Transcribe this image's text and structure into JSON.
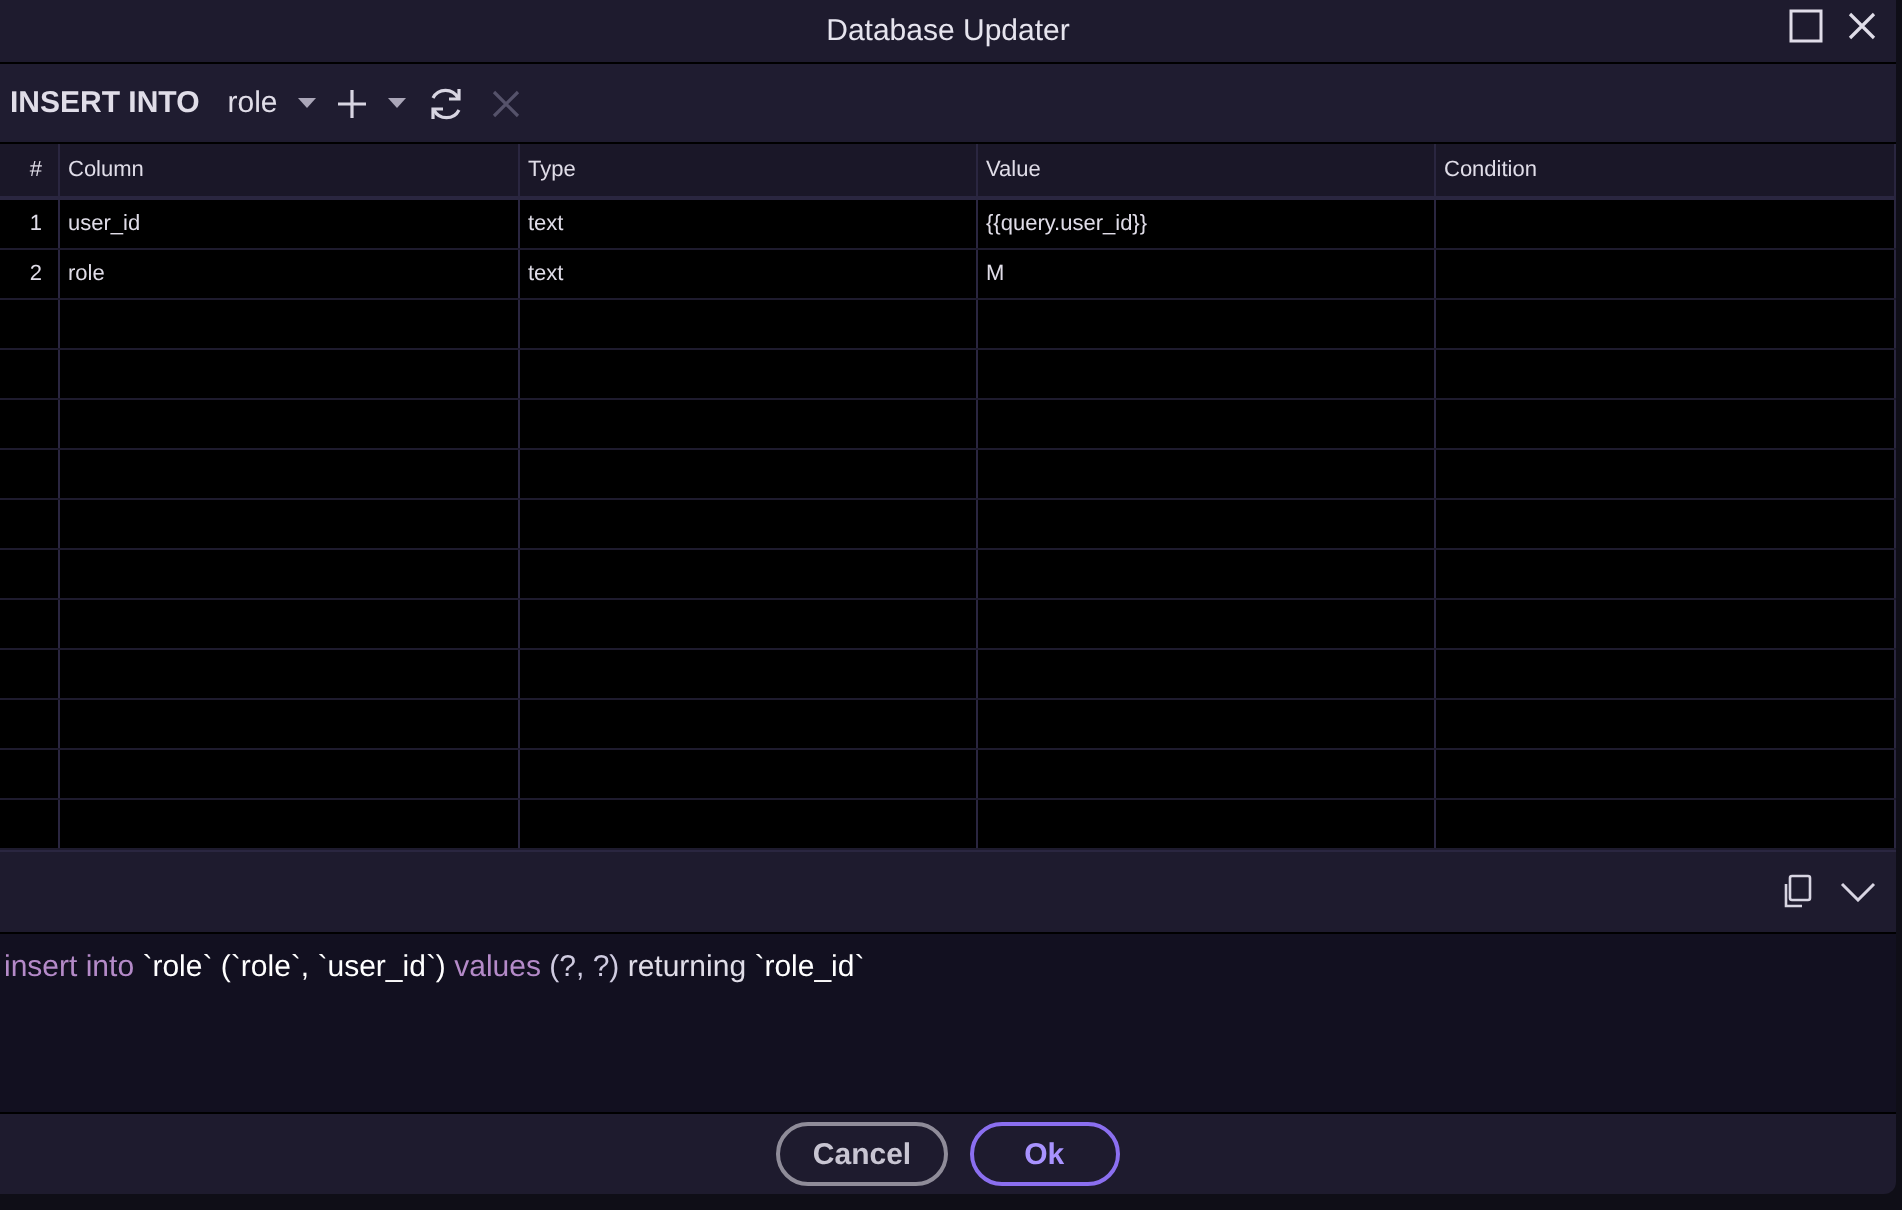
{
  "window": {
    "title": "Database Updater"
  },
  "toolbar": {
    "statement": "INSERT INTO",
    "table": "role",
    "add_disabled": false,
    "remove_disabled": true
  },
  "table": {
    "columns": [
      "#",
      "Column",
      "Type",
      "Value",
      "Condition"
    ],
    "rows": [
      {
        "cells": [
          "1",
          "user_id",
          "text",
          "{{query.user_id}}",
          ""
        ]
      },
      {
        "cells": [
          "2",
          "role",
          "text",
          "M",
          ""
        ]
      }
    ]
  },
  "sql": {
    "tokens": [
      {
        "kind": "keyword",
        "text": "insert into"
      },
      {
        "kind": "ident",
        "text": "`role`"
      },
      {
        "kind": "ident",
        "text": "(`role`,"
      },
      {
        "kind": "ident",
        "text": "`user_id`)"
      },
      {
        "kind": "keyword",
        "text": "values"
      },
      {
        "kind": "punct",
        "text": "(?, ?)"
      },
      {
        "kind": "plain",
        "text": "returning"
      },
      {
        "kind": "ident",
        "text": "`role_id`"
      }
    ]
  },
  "buttons": [
    {
      "label": "Cancel",
      "kind": "secondary"
    },
    {
      "label": "Ok",
      "kind": "primary"
    }
  ]
}
